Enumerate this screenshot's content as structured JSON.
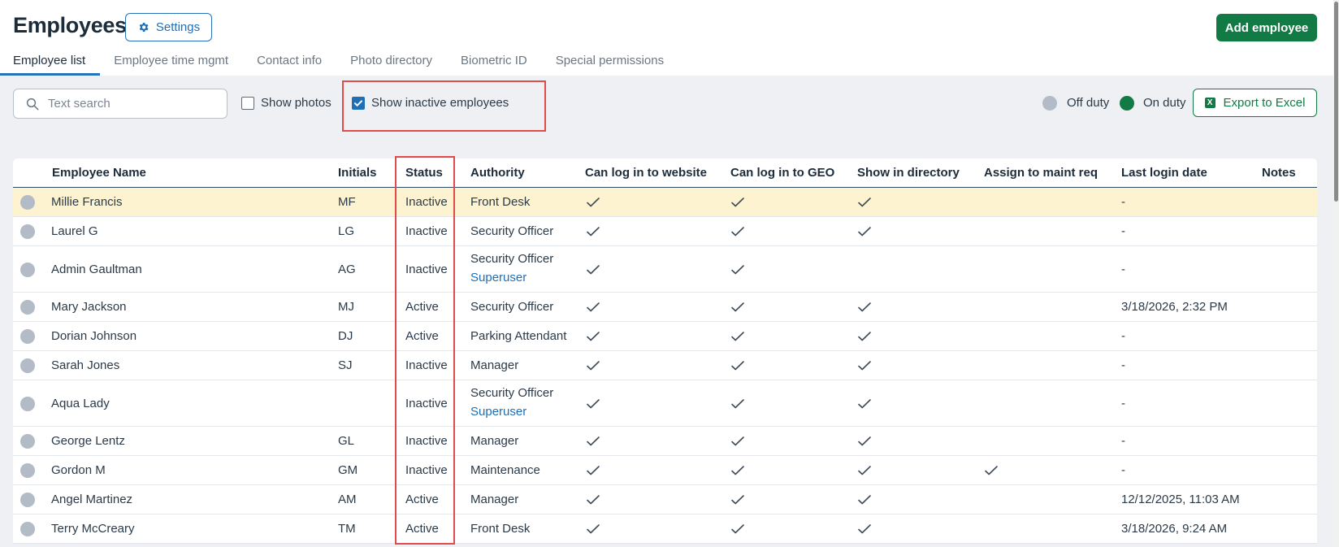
{
  "header": {
    "title": "Employees",
    "settings_label": "Settings",
    "add_label": "Add employee"
  },
  "tabs": [
    {
      "label": "Employee list",
      "active": true
    },
    {
      "label": "Employee time mgmt",
      "active": false
    },
    {
      "label": "Contact info",
      "active": false
    },
    {
      "label": "Photo directory",
      "active": false
    },
    {
      "label": "Biometric ID",
      "active": false
    },
    {
      "label": "Special permissions",
      "active": false
    }
  ],
  "filters": {
    "search_placeholder": "Text search",
    "show_photos_label": "Show photos",
    "show_photos_checked": false,
    "show_inactive_label": "Show inactive employees",
    "show_inactive_checked": true
  },
  "legend": {
    "off_duty_label": "Off duty",
    "on_duty_label": "On duty",
    "off_duty_color": "#b3bcc6",
    "on_duty_color": "#127a45"
  },
  "export_label": "Export to Excel",
  "table": {
    "columns": [
      "Employee Name",
      "Initials",
      "Status",
      "Authority",
      "Can log in to website",
      "Can log in to GEO",
      "Show in directory",
      "Assign to maint req",
      "Last login date",
      "Notes"
    ],
    "rows": [
      {
        "name": "Millie Francis",
        "initials": "MF",
        "status": "Inactive",
        "authority": "Front Desk",
        "superuser": "",
        "website": true,
        "geo": true,
        "directory": true,
        "maint": false,
        "last_login": "-",
        "highlight": true
      },
      {
        "name": "Laurel G",
        "initials": "LG",
        "status": "Inactive",
        "authority": "Security Officer",
        "superuser": "",
        "website": true,
        "geo": true,
        "directory": true,
        "maint": false,
        "last_login": "-"
      },
      {
        "name": "Admin Gaultman",
        "initials": "AG",
        "status": "Inactive",
        "authority": "Security Officer",
        "superuser": "Superuser",
        "website": true,
        "geo": true,
        "directory": false,
        "maint": false,
        "last_login": "-"
      },
      {
        "name": "Mary Jackson",
        "initials": "MJ",
        "status": "Active",
        "authority": "Security Officer",
        "superuser": "",
        "website": true,
        "geo": true,
        "directory": true,
        "maint": false,
        "last_login": "3/18/2026, 2:32 PM"
      },
      {
        "name": "Dorian Johnson",
        "initials": "DJ",
        "status": "Active",
        "authority": "Parking Attendant",
        "superuser": "",
        "website": true,
        "geo": true,
        "directory": true,
        "maint": false,
        "last_login": "-"
      },
      {
        "name": "Sarah Jones",
        "initials": "SJ",
        "status": "Inactive",
        "authority": "Manager",
        "superuser": "",
        "website": true,
        "geo": true,
        "directory": true,
        "maint": false,
        "last_login": "-"
      },
      {
        "name": "Aqua Lady",
        "initials": "",
        "status": "Inactive",
        "authority": "Security Officer",
        "superuser": "Superuser",
        "website": true,
        "geo": true,
        "directory": true,
        "maint": false,
        "last_login": "-"
      },
      {
        "name": "George Lentz",
        "initials": "GL",
        "status": "Inactive",
        "authority": "Manager",
        "superuser": "",
        "website": true,
        "geo": true,
        "directory": true,
        "maint": false,
        "last_login": "-"
      },
      {
        "name": "Gordon M",
        "initials": "GM",
        "status": "Inactive",
        "authority": "Maintenance",
        "superuser": "",
        "website": true,
        "geo": true,
        "directory": true,
        "maint": true,
        "last_login": "-"
      },
      {
        "name": "Angel Martinez",
        "initials": "AM",
        "status": "Active",
        "authority": "Manager",
        "superuser": "",
        "website": true,
        "geo": true,
        "directory": true,
        "maint": false,
        "last_login": "12/12/2025, 11:03 AM"
      },
      {
        "name": "Terry McCreary",
        "initials": "TM",
        "status": "Active",
        "authority": "Front Desk",
        "superuser": "",
        "website": true,
        "geo": true,
        "directory": true,
        "maint": false,
        "last_login": "3/18/2026, 9:24 AM"
      }
    ]
  }
}
